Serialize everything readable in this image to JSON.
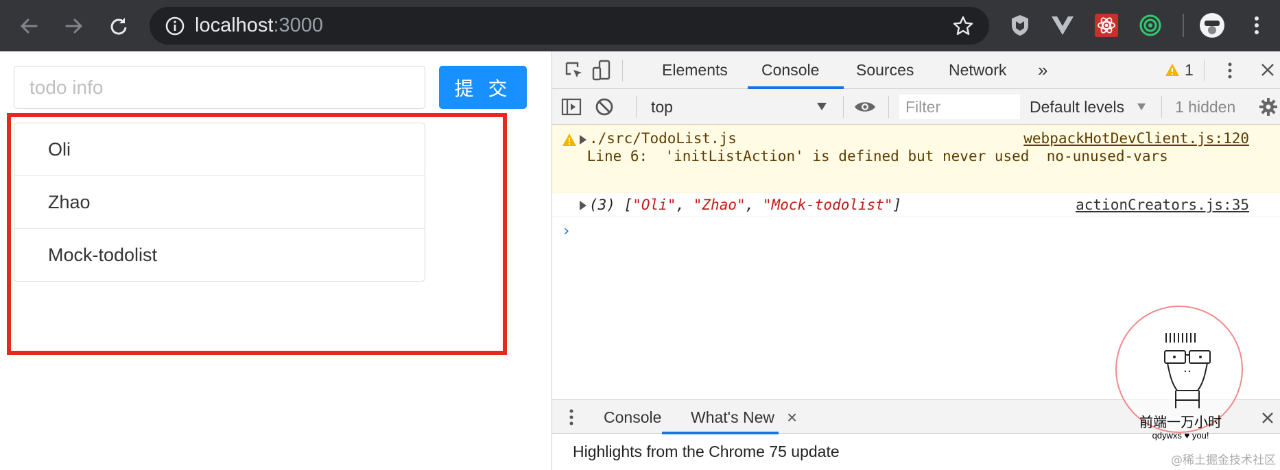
{
  "browser": {
    "url_host": "localhost",
    "url_port": ":3000",
    "icons": [
      "back-icon",
      "forward-icon",
      "reload-icon",
      "info-icon",
      "star-icon",
      "shield-extension-icon",
      "vue-extension-icon",
      "react-extension-icon",
      "target-extension-icon",
      "profile-avatar",
      "menu-icon"
    ]
  },
  "app": {
    "input_placeholder": "todo info",
    "submit_label": "提 交",
    "items": [
      "Oli",
      "Zhao",
      "Mock-todolist"
    ],
    "highlight_color": "#e8271d",
    "accent": "#1890ff"
  },
  "devtools": {
    "tabs": [
      "Elements",
      "Console",
      "Sources",
      "Network"
    ],
    "more_tabs": "»",
    "active_tab": "Console",
    "warning_count": "1",
    "context": "top",
    "filter_placeholder": "Filter",
    "levels": "Default levels",
    "hidden": "1 hidden",
    "console": {
      "warning_path": "./src/TodoList.js",
      "warning_link": "webpackHotDevClient.js:120",
      "warning_message": " Line 6:  'initListAction' is defined but never used  no-unused-vars",
      "log_count": "(3)",
      "log_open": "[",
      "log_items": [
        "\"Oli\"",
        "\"Zhao\"",
        "\"Mock-todolist\""
      ],
      "log_sep": ", ",
      "log_close": "]",
      "log_link": "actionCreators.js:35",
      "prompt": "›"
    },
    "drawer": {
      "tabs": [
        "Console",
        "What's New"
      ],
      "active_tab": "What's New",
      "close_glyph": "×",
      "content": "Highlights from the Chrome 75 update"
    }
  },
  "watermark": {
    "title": "前端一万小时",
    "subtitle": "qdywxs ♥ you!",
    "corner": "@稀土掘金技术社区"
  }
}
